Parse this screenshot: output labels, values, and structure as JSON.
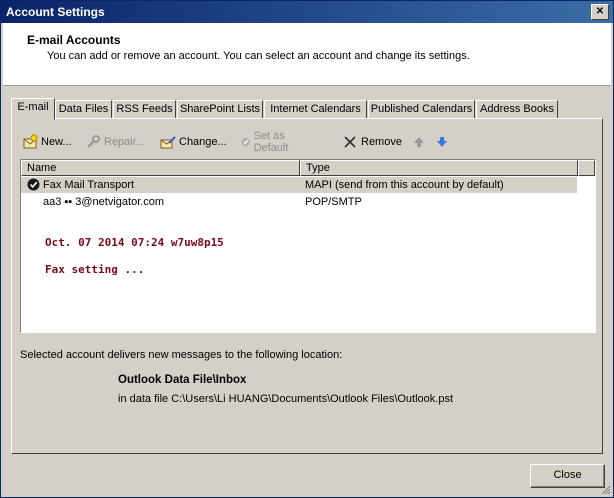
{
  "window": {
    "title": "Account Settings"
  },
  "header": {
    "title": "E-mail Accounts",
    "subtitle": "You can add or remove an account. You can select an account and change its settings."
  },
  "tabs": [
    {
      "label": "E-mail",
      "active": true
    },
    {
      "label": "Data Files"
    },
    {
      "label": "RSS Feeds"
    },
    {
      "label": "SharePoint Lists"
    },
    {
      "label": "Internet Calendars"
    },
    {
      "label": "Published Calendars"
    },
    {
      "label": "Address Books"
    }
  ],
  "toolbar": {
    "new_label": "New...",
    "repair_label": "Repair...",
    "change_label": "Change...",
    "default_label": "Set as Default",
    "remove_label": "Remove"
  },
  "list": {
    "col_name": "Name",
    "col_type": "Type",
    "rows": [
      {
        "name": "Fax Mail Transport",
        "type": "MAPI (send from this account by default)"
      },
      {
        "name": "aa3  ▪▪  3@netvigator.com",
        "type": "POP/SMTP"
      }
    ],
    "stamp_line1": "Oct. 07 2014  07:24 w7uw8p15",
    "stamp_line2": "Fax setting ..."
  },
  "delivery": {
    "intro": "Selected account delivers new messages to the following location:",
    "folder": "Outlook Data File\\Inbox",
    "path": "in data file C:\\Users\\Li HUANG\\Documents\\Outlook Files\\Outlook.pst"
  },
  "footer": {
    "close_label": "Close"
  }
}
